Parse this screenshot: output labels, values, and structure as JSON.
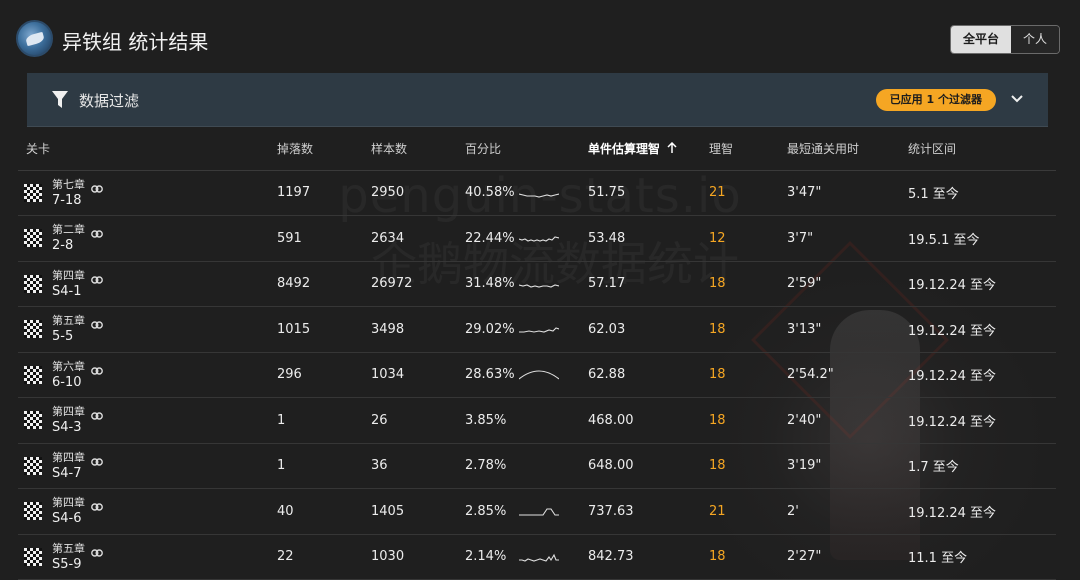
{
  "header": {
    "title": "异铁组 统计结果",
    "toggle": {
      "options": [
        "全平台",
        "个人"
      ],
      "selected": "全平台"
    }
  },
  "filter": {
    "label": "数据过滤",
    "badge": "已应用 1 个过滤器"
  },
  "watermark": {
    "line1": "penguin-stats.io",
    "line2": "企鹅物流数据统计"
  },
  "table": {
    "columns": [
      "关卡",
      "掉落数",
      "样本数",
      "百分比",
      "单件估算理智",
      "理智",
      "最短通关用时",
      "统计区间"
    ],
    "sorted_column": "单件估算理智",
    "rows": [
      {
        "chapter": "第七章",
        "code": "7-18",
        "times": "1197",
        "samples": "2950",
        "pct": "40.58%",
        "apc": "51.75",
        "ap": "21",
        "time": "3'47\"",
        "range": "5.1 至今"
      },
      {
        "chapter": "第二章",
        "code": "2-8",
        "times": "591",
        "samples": "2634",
        "pct": "22.44%",
        "apc": "53.48",
        "ap": "12",
        "time": "3'7\"",
        "range": "19.5.1 至今"
      },
      {
        "chapter": "第四章",
        "code": "S4-1",
        "times": "8492",
        "samples": "26972",
        "pct": "31.48%",
        "apc": "57.17",
        "ap": "18",
        "time": "2'59\"",
        "range": "19.12.24 至今"
      },
      {
        "chapter": "第五章",
        "code": "5-5",
        "times": "1015",
        "samples": "3498",
        "pct": "29.02%",
        "apc": "62.03",
        "ap": "18",
        "time": "3'13\"",
        "range": "19.12.24 至今"
      },
      {
        "chapter": "第六章",
        "code": "6-10",
        "times": "296",
        "samples": "1034",
        "pct": "28.63%",
        "apc": "62.88",
        "ap": "18",
        "time": "2'54.2\"",
        "range": "19.12.24 至今"
      },
      {
        "chapter": "第四章",
        "code": "S4-3",
        "times": "1",
        "samples": "26",
        "pct": "3.85%",
        "apc": "468.00",
        "ap": "18",
        "time": "2'40\"",
        "range": "19.12.24 至今"
      },
      {
        "chapter": "第四章",
        "code": "S4-7",
        "times": "1",
        "samples": "36",
        "pct": "2.78%",
        "apc": "648.00",
        "ap": "18",
        "time": "3'19\"",
        "range": "1.7 至今"
      },
      {
        "chapter": "第四章",
        "code": "S4-6",
        "times": "40",
        "samples": "1405",
        "pct": "2.85%",
        "apc": "737.63",
        "ap": "21",
        "time": "2'",
        "range": "19.12.24 至今"
      },
      {
        "chapter": "第五章",
        "code": "S5-9",
        "times": "22",
        "samples": "1030",
        "pct": "2.14%",
        "apc": "842.73",
        "ap": "18",
        "time": "2'27\"",
        "range": "11.1 至今"
      }
    ]
  },
  "icons": {
    "filter": "filter-icon",
    "expand": "chevron-down-icon",
    "sort": "arrow-up-icon",
    "stage": "checkered-flag-icon",
    "link": "link-icon"
  },
  "colors": {
    "accent": "#f5a623",
    "filter_bar": "#2e3a44",
    "background": "#1f1f1f"
  }
}
